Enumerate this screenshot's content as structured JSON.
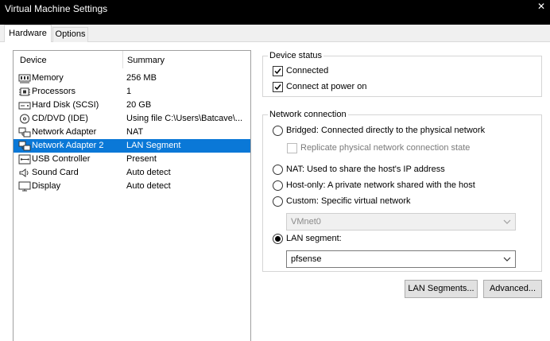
{
  "window": {
    "title": "Virtual Machine Settings"
  },
  "tabs": [
    {
      "label": "Hardware",
      "active": true
    },
    {
      "label": "Options",
      "active": false
    }
  ],
  "device_list": {
    "headers": {
      "device": "Device",
      "summary": "Summary"
    },
    "rows": [
      {
        "name": "Memory",
        "summary": "256 MB",
        "icon": "memory-icon"
      },
      {
        "name": "Processors",
        "summary": "1",
        "icon": "processor-icon"
      },
      {
        "name": "Hard Disk (SCSI)",
        "summary": "20 GB",
        "icon": "hard-disk-icon"
      },
      {
        "name": "CD/DVD (IDE)",
        "summary": "Using file C:\\Users\\Batcave\\...",
        "icon": "cd-dvd-icon"
      },
      {
        "name": "Network Adapter",
        "summary": "NAT",
        "icon": "network-adapter-icon"
      },
      {
        "name": "Network Adapter 2",
        "summary": "LAN Segment",
        "icon": "network-adapter-icon",
        "selected": true
      },
      {
        "name": "USB Controller",
        "summary": "Present",
        "icon": "usb-icon"
      },
      {
        "name": "Sound Card",
        "summary": "Auto detect",
        "icon": "speaker-icon"
      },
      {
        "name": "Display",
        "summary": "Auto detect",
        "icon": "monitor-icon"
      }
    ]
  },
  "device_status": {
    "title": "Device status",
    "connected": {
      "label": "Connected",
      "checked": true
    },
    "connect_at_power_on": {
      "label": "Connect at power on",
      "checked": true
    }
  },
  "network_connection": {
    "title": "Network connection",
    "bridged": {
      "label": "Bridged: Connected directly to the physical network",
      "selected": false
    },
    "replicate": {
      "label": "Replicate physical network connection state",
      "checked": false,
      "enabled": false
    },
    "nat": {
      "label": "NAT: Used to share the host's IP address",
      "selected": false
    },
    "host_only": {
      "label": "Host-only: A private network shared with the host",
      "selected": false
    },
    "custom": {
      "label": "Custom: Specific virtual network",
      "selected": false
    },
    "custom_select": {
      "value": "VMnet0",
      "enabled": false
    },
    "lan_segment": {
      "label": "LAN segment:",
      "selected": true
    },
    "lan_select": {
      "value": "pfsense",
      "enabled": true
    }
  },
  "buttons": {
    "lan_segments": "LAN Segments...",
    "advanced": "Advanced..."
  },
  "colors": {
    "selection": "#0a78d7",
    "titlebar": "#000000"
  }
}
